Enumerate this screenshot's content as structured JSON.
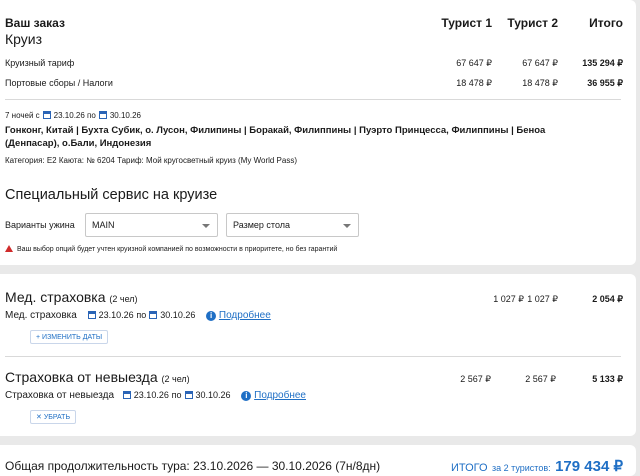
{
  "order": {
    "title": "Ваш заказ",
    "subtitle": "Круиз",
    "col_t1": "Турист 1",
    "col_t2": "Турист 2",
    "col_total": "Итого",
    "rows": [
      {
        "label": "Круизный тариф",
        "t1": "67 647 ₽",
        "t2": "67 647 ₽",
        "total": "135 294 ₽"
      },
      {
        "label": "Портовые сборы / Налоги",
        "t1": "18 478 ₽",
        "t2": "18 478 ₽",
        "total": "36 955 ₽"
      }
    ]
  },
  "cruise": {
    "nights": "7 ночей с",
    "date_from": "23.10.26",
    "po": "по",
    "date_to": "30.10.26",
    "route_line1": "Гонконг, Китай | Бухта Субик, о. Лусон, Филипины | Боракай, Филиппины | Пуэрто Принцесса, Филиппины | Беноа",
    "route_line2": "(Денпасар), о.Бали, Индонезия",
    "details": "Категория: E2  Каюта: № 6204  Тариф: Мой кругосветный круиз (My World Pass)"
  },
  "service": {
    "title": "Специальный сервис на круизе",
    "dinner_label": "Варианты ужина",
    "dinner_value": "MAIN",
    "table_value": "Размер стола",
    "warning": "Ваш выбор опций будет учтен круизной компанией по возможности в приоритете, но без гарантий"
  },
  "insurance_med": {
    "title": "Мед. страховка",
    "count": "(2 чел)",
    "t1": "1 027 ₽",
    "t2": "1 027 ₽",
    "total": "2 054 ₽",
    "label": "Мед. страховка",
    "date_from": "23.10.26",
    "po": "по",
    "date_to": "30.10.26",
    "more": "Подробнее",
    "change_btn": "ИЗМЕНИТЬ ДАТЫ"
  },
  "insurance_cancel": {
    "title": "Страховка от невыезда",
    "count": "(2 чел)",
    "t1": "2 567 ₽",
    "t2": "2 567 ₽",
    "total": "5 133 ₽",
    "label": "Страховка от невыезда",
    "date_from": "23.10.26",
    "po": "по",
    "date_to": "30.10.26",
    "more": "Подробнее",
    "remove_btn": "УБРАТЬ"
  },
  "footer": {
    "duration": "Общая продолжительность тура: 23.10.2026 — 30.10.2026 (7н/8дн)",
    "total_label": "ИТОГО",
    "total_for": "за 2 туристов:",
    "total_value": "179 434 ₽"
  },
  "colors": {
    "accent": "#1f6fc5",
    "warning": "#d02b2b"
  }
}
